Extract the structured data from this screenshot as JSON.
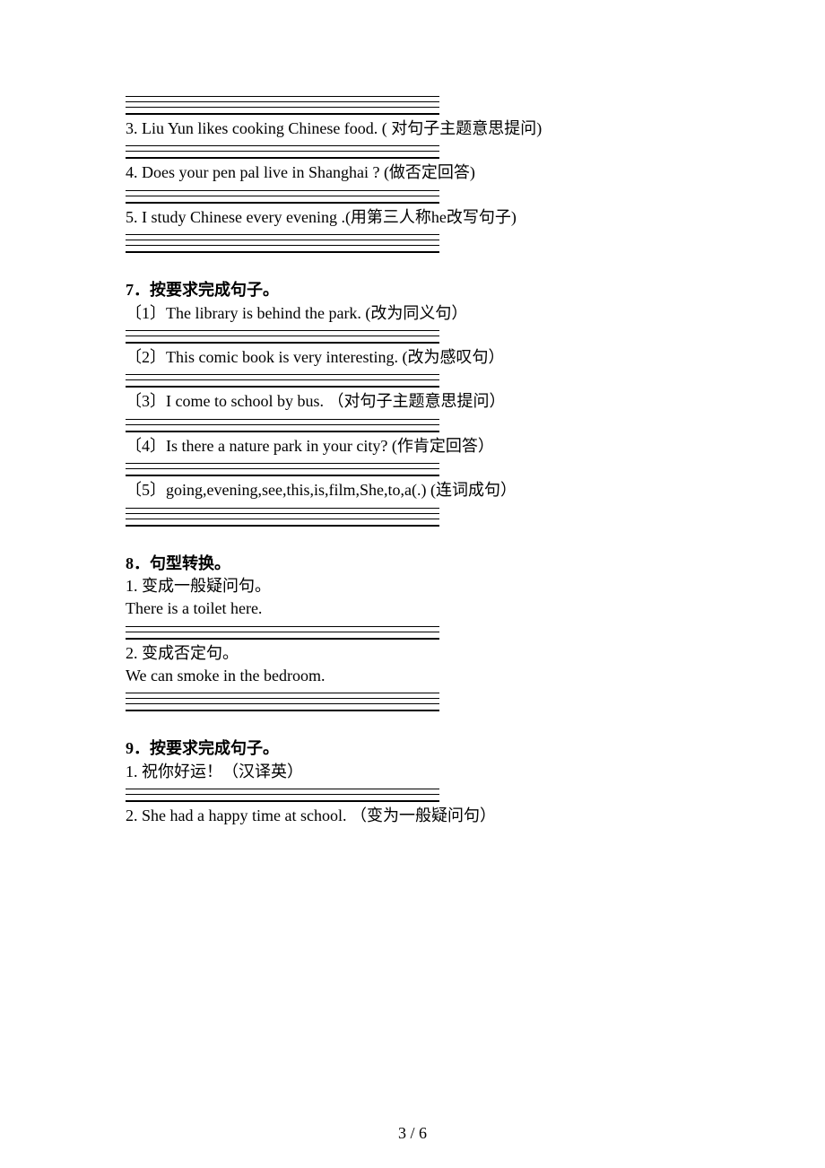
{
  "block_a": {
    "q3": "3. Liu Yun likes cooking Chinese food. ( 对句子主题意思提问)",
    "q4": "4. Does your pen pal live in Shanghai ? (做否定回答)",
    "q5": "5. I study Chinese every evening .(用第三人称he改写句子)"
  },
  "section7": {
    "head": "7．按要求完成句子。",
    "q1": "〔1〕The library is behind the park.  (改为同义句）",
    "q2": "〔2〕This comic book is very interesting.  (改为感叹句）",
    "q3": "〔3〕I come to school by bus. （对句子主题意思提问）",
    "q4": "〔4〕Is there a nature park in your city?  (作肯定回答）",
    "q5": "〔5〕going,evening,see,this,is,film,She,to,a(.)  (连词成句）"
  },
  "section8": {
    "head": "8．句型转换。",
    "q1_l1": "1. 变成一般疑问句。",
    "q1_l2": "There is a toilet here.",
    "q2_l1": "2. 变成否定句。",
    "q2_l2": "We can smoke in the bedroom."
  },
  "section9": {
    "head": "9．按要求完成句子。",
    "q1": "1. 祝你好运！（汉译英）",
    "q2": "2. She had a happy time at school. （变为一般疑问句）"
  },
  "footer": "3 / 6"
}
